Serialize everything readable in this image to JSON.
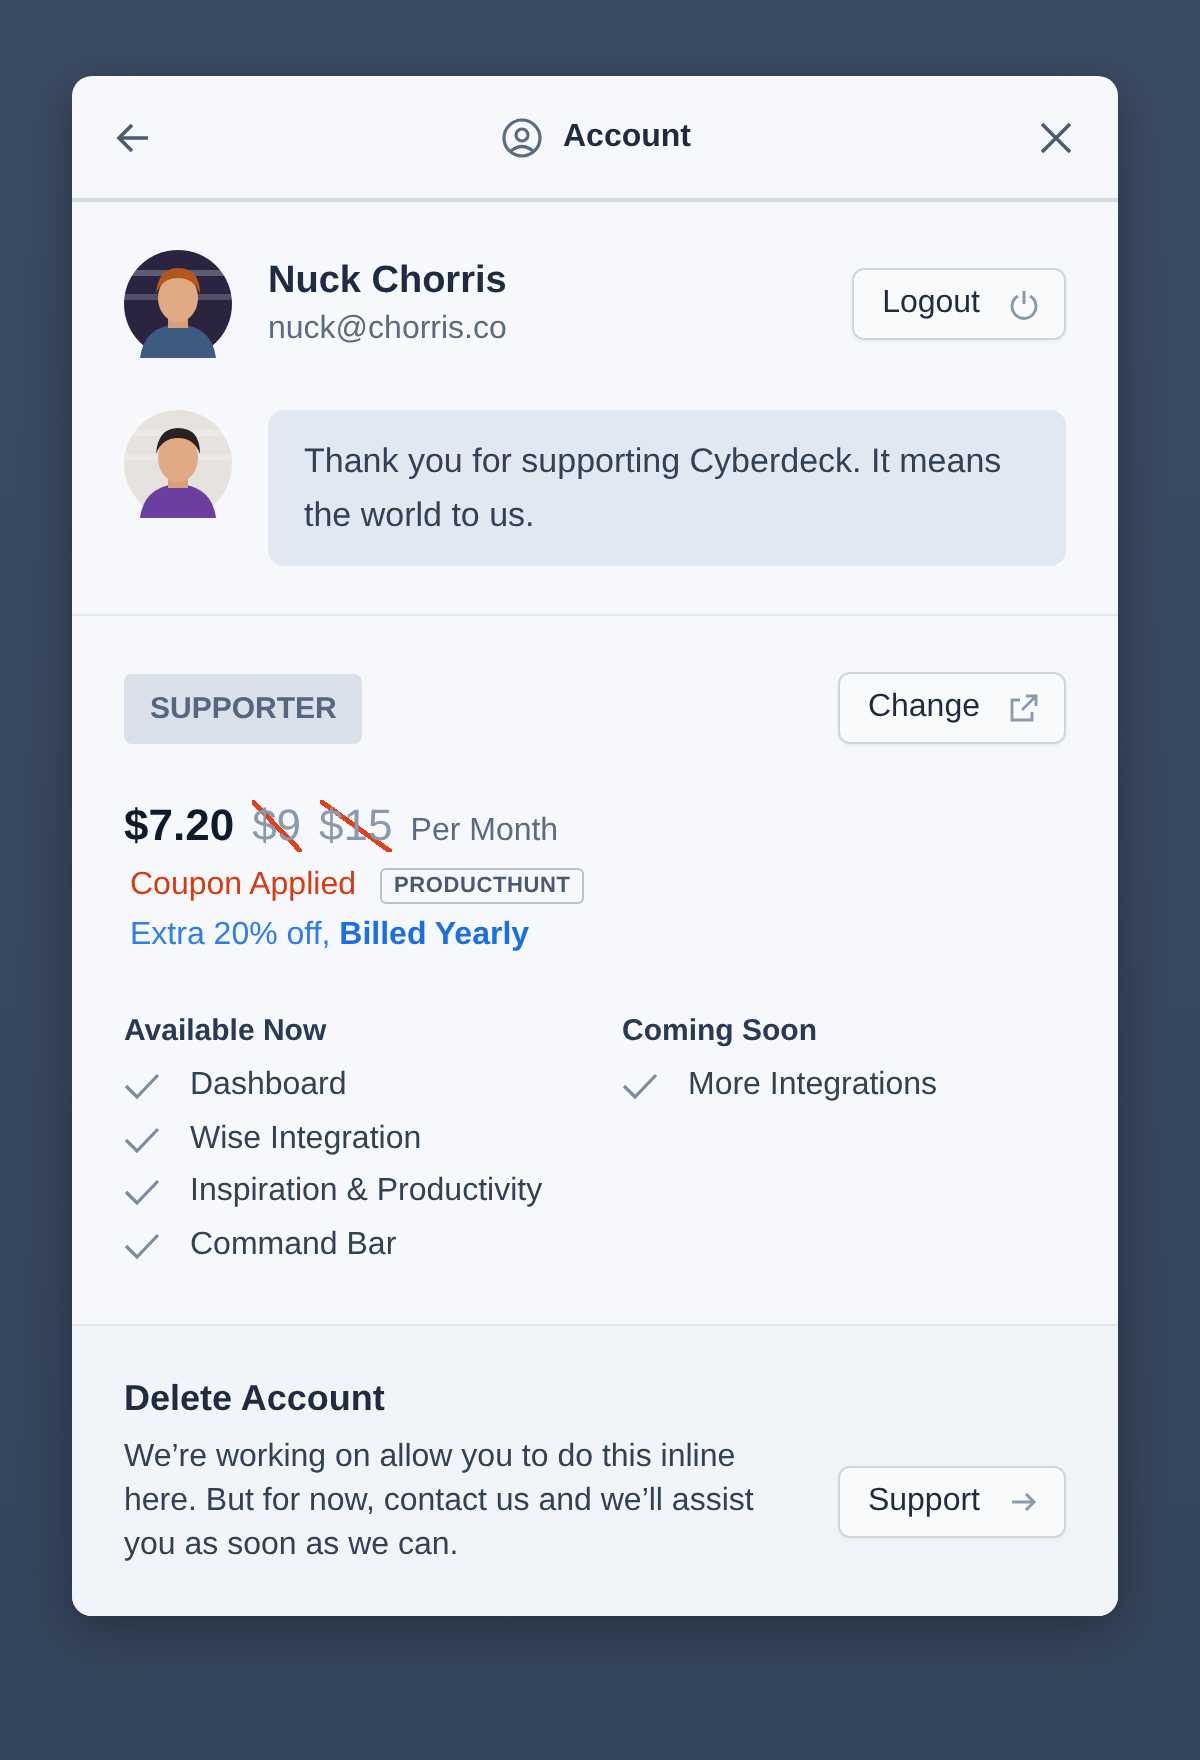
{
  "header": {
    "title": "Account"
  },
  "profile": {
    "name": "Nuck Chorris",
    "email": "nuck@chorris.co",
    "logout_label": "Logout"
  },
  "message": {
    "text": "Thank you for supporting Cyberdeck. It means the world to us."
  },
  "plan": {
    "tier": "SUPPORTER",
    "change_label": "Change",
    "price": "$7.20",
    "old_prices": [
      {
        "text": "$9",
        "struck": true
      },
      {
        "text": "$15",
        "struck": true
      }
    ],
    "period": "Per Month",
    "coupon_label": "Coupon Applied",
    "coupon_code": "PRODUCTHUNT",
    "extra": "Extra 20% off, **Billed Yearly**"
  },
  "feature_columns": [
    {
      "title": "Available Now",
      "items": [
        {
          "label": "Dashboard",
          "checked": true
        },
        {
          "label": "Wise Integration",
          "checked": true
        },
        {
          "label": "Inspiration & Productivity",
          "checked": true
        },
        {
          "label": "Command Bar",
          "checked": true
        }
      ]
    },
    {
      "title": "Coming Soon",
      "items": [
        {
          "label": "More Integrations",
          "checked": true
        }
      ]
    }
  ],
  "delete": {
    "title": "Delete Account",
    "text": "We’re working on allow you to do this inline here. But for now, contact us and we’ll assist you as soon as we can.",
    "button": "Support"
  }
}
